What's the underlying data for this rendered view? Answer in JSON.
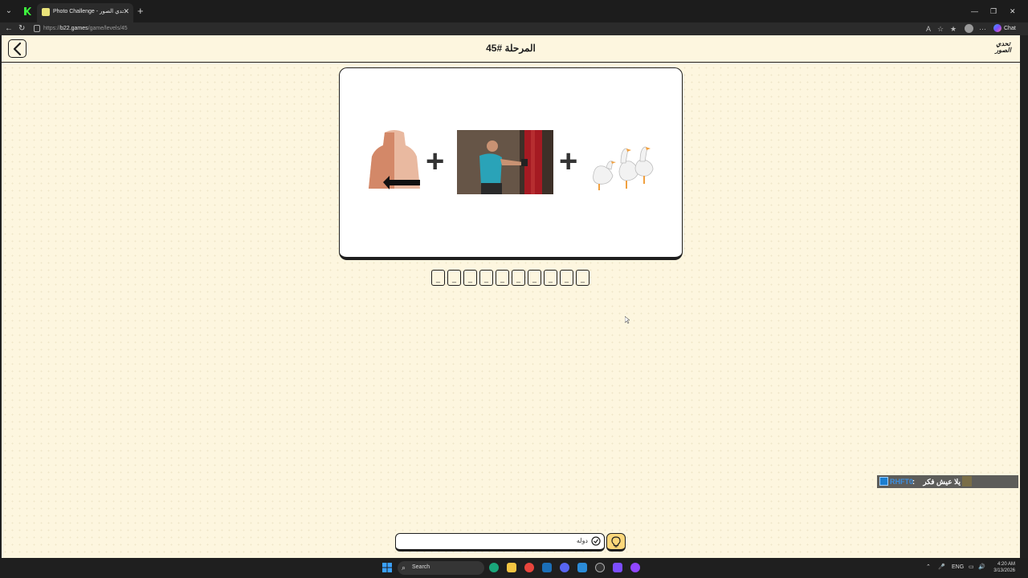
{
  "browser": {
    "tab_title": "Photo Challenge - لعبة تحدي الصور",
    "new_tab": "+",
    "tab_close": "✕",
    "url_prefix": "https://",
    "url_host": "b22.games",
    "url_path": "/game/levels/45",
    "chat_label": "Chat"
  },
  "game": {
    "level_title": "المرحلة #45",
    "logo_line1": "تحدي",
    "logo_line2": "الصور",
    "clues": [
      "back-torso",
      "boxer-punching-bag",
      "geese"
    ],
    "plus_sign": "+",
    "slots": [
      "_",
      "_",
      "_",
      "_",
      "_",
      "_",
      "_",
      "_",
      "_",
      "_"
    ],
    "answer_value": "دوله"
  },
  "overlay": {
    "username": "RHFT0",
    "separator": ":",
    "message": "يلا عيش فكر"
  },
  "taskbar": {
    "search_label": "Search",
    "language": "ENG",
    "time": "4:20 AM",
    "date": "3/13/2026"
  },
  "colors": {
    "page_bg": "#fdf6df",
    "hint_button": "#fcd77a",
    "ink": "#1e1e1e"
  }
}
